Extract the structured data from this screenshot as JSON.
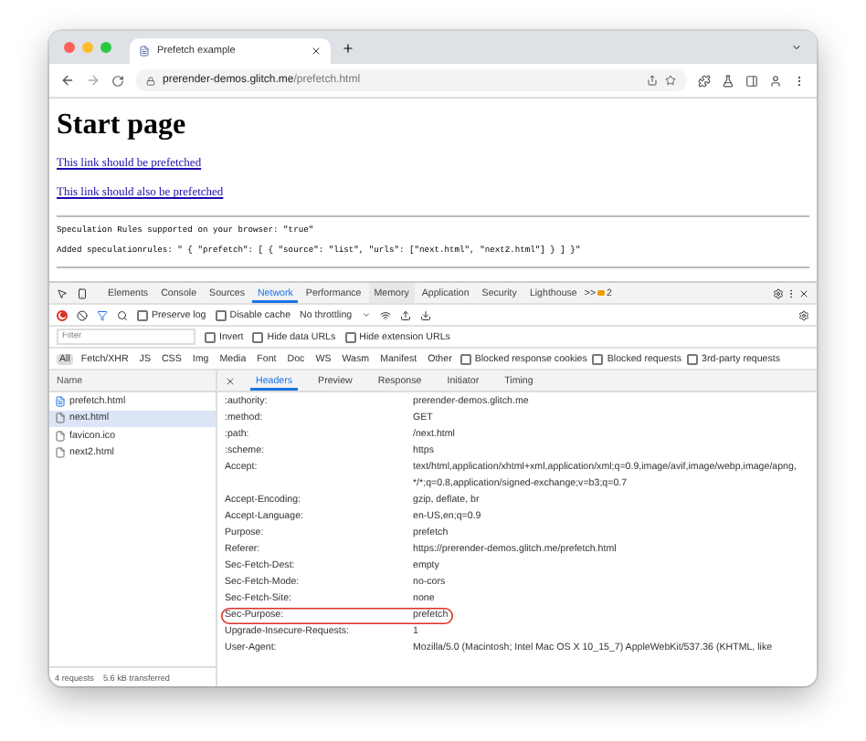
{
  "browser_tab": {
    "title": "Prefetch example"
  },
  "address": {
    "host": "prerender-demos.glitch.me",
    "path": "/prefetch.html"
  },
  "page": {
    "heading": "Start page",
    "links": [
      "This link should be prefetched",
      "This link should also be prefetched"
    ],
    "lines": [
      "Speculation Rules supported on your browser: \"true\"",
      "Added speculationrules: \" { \"prefetch\": [ { \"source\": \"list\", \"urls\": [\"next.html\", \"next2.html\"] } ] }\""
    ]
  },
  "devtools": {
    "tabs": [
      {
        "label": "Elements",
        "selected": false,
        "hovered": false
      },
      {
        "label": "Console",
        "selected": false,
        "hovered": false
      },
      {
        "label": "Sources",
        "selected": false,
        "hovered": false
      },
      {
        "label": "Network",
        "selected": true,
        "hovered": false
      },
      {
        "label": "Performance",
        "selected": false,
        "hovered": false
      },
      {
        "label": "Memory",
        "selected": false,
        "hovered": true
      },
      {
        "label": "Application",
        "selected": false,
        "hovered": false
      },
      {
        "label": "Security",
        "selected": false,
        "hovered": false
      },
      {
        "label": "Lighthouse",
        "selected": false,
        "hovered": false
      }
    ],
    "more": ">>",
    "issues": "2",
    "recording": true,
    "toolbar_checks": [
      {
        "label": "Preserve log",
        "checked": false
      },
      {
        "label": "Disable cache",
        "checked": false
      }
    ],
    "throttling": "No throttling",
    "filter": {
      "placeholder": "Filter"
    },
    "filter_checks": [
      {
        "label": "Invert",
        "checked": false
      },
      {
        "label": "Hide data URLs",
        "checked": false
      },
      {
        "label": "Hide extension URLs",
        "checked": false
      }
    ],
    "types": [
      {
        "label": "All",
        "selected": true
      },
      {
        "label": "Fetch/XHR",
        "selected": false
      },
      {
        "label": "JS",
        "selected": false
      },
      {
        "label": "CSS",
        "selected": false
      },
      {
        "label": "Img",
        "selected": false
      },
      {
        "label": "Media",
        "selected": false
      },
      {
        "label": "Font",
        "selected": false
      },
      {
        "label": "Doc",
        "selected": false
      },
      {
        "label": "WS",
        "selected": false
      },
      {
        "label": "Wasm",
        "selected": false
      },
      {
        "label": "Manifest",
        "selected": false
      },
      {
        "label": "Other",
        "selected": false
      }
    ],
    "type_checks": [
      {
        "label": "Blocked response cookies",
        "checked": false
      },
      {
        "label": "Blocked requests",
        "checked": false
      },
      {
        "label": "3rd-party requests",
        "checked": false
      }
    ],
    "name_column": "Name",
    "requests": [
      {
        "name": "prefetch.html",
        "kind": "document",
        "selected": false
      },
      {
        "name": "next.html",
        "kind": "file",
        "selected": true
      },
      {
        "name": "favicon.ico",
        "kind": "file",
        "selected": false
      },
      {
        "name": "next2.html",
        "kind": "file",
        "selected": false
      }
    ],
    "detail_tabs": [
      {
        "label": "Headers",
        "selected": true
      },
      {
        "label": "Preview",
        "selected": false
      },
      {
        "label": "Response",
        "selected": false
      },
      {
        "label": "Initiator",
        "selected": false
      },
      {
        "label": "Timing",
        "selected": false
      }
    ],
    "headers": [
      {
        "name": ":authority:",
        "value": "prerender-demos.glitch.me",
        "highlighted": false
      },
      {
        "name": ":method:",
        "value": "GET",
        "highlighted": false
      },
      {
        "name": ":path:",
        "value": "/next.html",
        "highlighted": false
      },
      {
        "name": ":scheme:",
        "value": "https",
        "highlighted": false
      },
      {
        "name": "Accept:",
        "value": "text/html,application/xhtml+xml,application/xml;q=0.9,image/avif,image/webp,image/apng,*/*;q=0.8,application/signed-exchange;v=b3;q=0.7",
        "highlighted": false
      },
      {
        "name": "Accept-Encoding:",
        "value": "gzip, deflate, br",
        "highlighted": false
      },
      {
        "name": "Accept-Language:",
        "value": "en-US,en;q=0.9",
        "highlighted": false
      },
      {
        "name": "Purpose:",
        "value": "prefetch",
        "highlighted": false
      },
      {
        "name": "Referer:",
        "value": "https://prerender-demos.glitch.me/prefetch.html",
        "highlighted": false
      },
      {
        "name": "Sec-Fetch-Dest:",
        "value": "empty",
        "highlighted": false
      },
      {
        "name": "Sec-Fetch-Mode:",
        "value": "no-cors",
        "highlighted": false
      },
      {
        "name": "Sec-Fetch-Site:",
        "value": "none",
        "highlighted": false
      },
      {
        "name": "Sec-Purpose:",
        "value": "prefetch",
        "highlighted": true
      },
      {
        "name": "Upgrade-Insecure-Requests:",
        "value": "1",
        "highlighted": false
      },
      {
        "name": "User-Agent:",
        "value": "Mozilla/5.0 (Macintosh; Intel Mac OS X 10_15_7) AppleWebKit/537.36 (KHTML, like",
        "highlighted": false
      }
    ],
    "status": [
      "4 requests",
      "5.6 kB transferred"
    ]
  }
}
